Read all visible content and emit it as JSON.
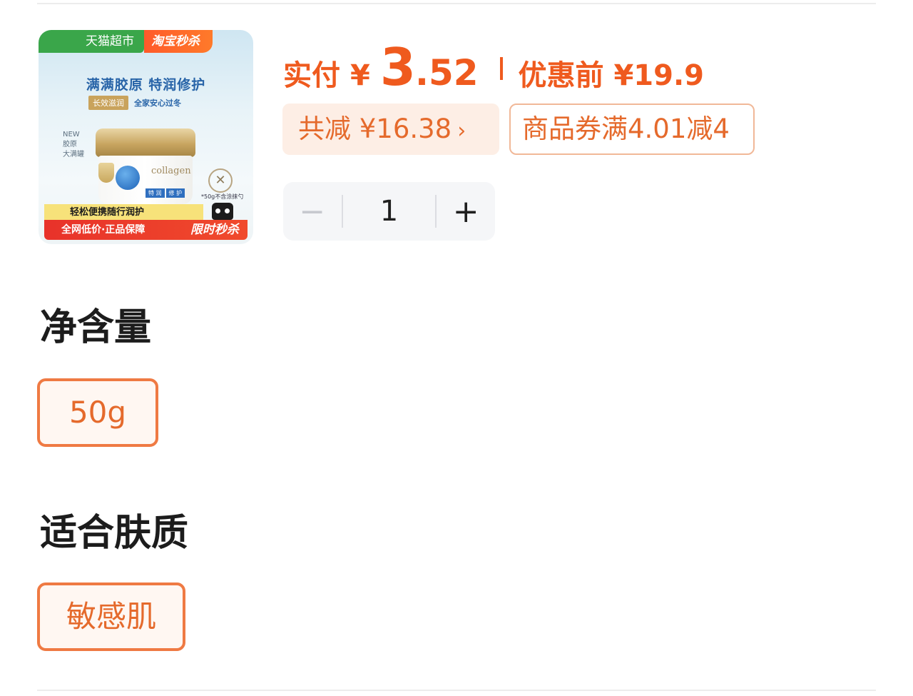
{
  "product": {
    "thumbnail": {
      "tag_tmall": "天猫超市",
      "tag_flash": "淘宝秒杀",
      "headline": "满满胶原 特润修护",
      "sub_a": "长效滋润",
      "sub_b": "全家安心过冬",
      "side_note_1": "NEW",
      "side_note_2": "胶原",
      "side_note_3": "大满罐",
      "jar_brand": "collagen",
      "jar_label_1": "特 润",
      "jar_label_2": "修 护",
      "cross_note": "*50g不含涂抹勺",
      "band_yellow": "轻松便携随行润护",
      "band_red_left": "全网低价·正品保障",
      "band_red_right": "限时秒杀"
    }
  },
  "price": {
    "label": "实付",
    "currency": "¥",
    "integer": "3",
    "decimal": ".52",
    "original_label": "优惠前 ¥19.9"
  },
  "discount": {
    "text": "共减 ¥16.38",
    "chevron": "›"
  },
  "coupon": {
    "text": "商品券满4.01减4"
  },
  "quantity": {
    "minus": "−",
    "value": "1",
    "plus": "+"
  },
  "specs": [
    {
      "title": "净含量",
      "selected": "50g"
    },
    {
      "title": "适合肤质",
      "selected": "敏感肌"
    }
  ],
  "colors": {
    "accent": "#ef5a1e",
    "chip_border": "#ef7a43",
    "chip_bg": "#fff7f2"
  }
}
